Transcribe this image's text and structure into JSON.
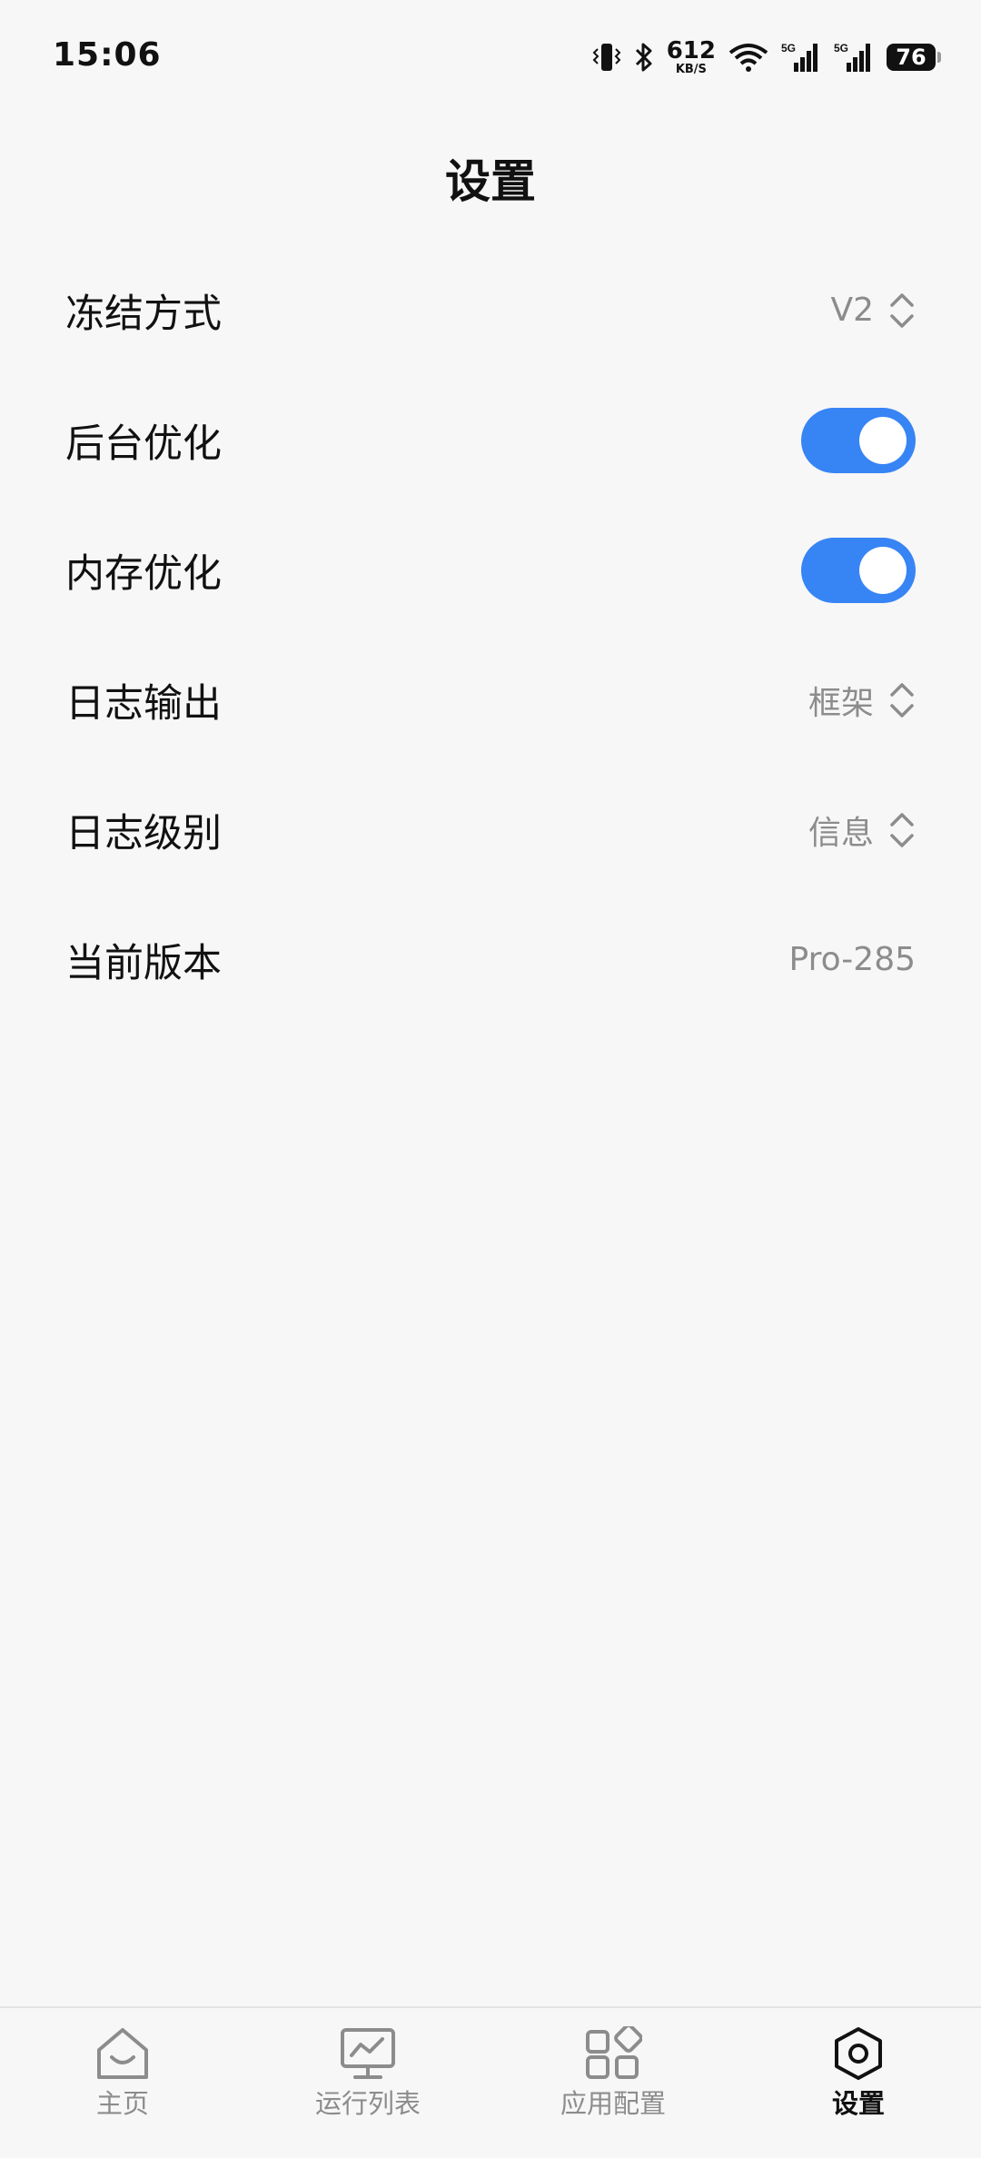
{
  "status_bar": {
    "time": "15:06",
    "net_speed": "612",
    "net_speed_unit": "KB/S",
    "battery": "76",
    "icons": [
      "vibrate-icon",
      "bluetooth-icon",
      "wifi-icon",
      "signal-5g-icon",
      "signal-5g-icon"
    ]
  },
  "header": {
    "title": "设置"
  },
  "settings": [
    {
      "label": "冻结方式",
      "type": "select",
      "value": "V2"
    },
    {
      "label": "后台优化",
      "type": "toggle",
      "enabled": true
    },
    {
      "label": "内存优化",
      "type": "toggle",
      "enabled": true
    },
    {
      "label": "日志输出",
      "type": "select",
      "value": "框架"
    },
    {
      "label": "日志级别",
      "type": "select",
      "value": "信息"
    },
    {
      "label": "当前版本",
      "type": "text",
      "value": "Pro-285"
    }
  ],
  "bottom_nav": {
    "items": [
      {
        "label": "主页",
        "icon": "home-icon",
        "active": false
      },
      {
        "label": "运行列表",
        "icon": "monitor-icon",
        "active": false
      },
      {
        "label": "应用配置",
        "icon": "apps-grid-icon",
        "active": false
      },
      {
        "label": "设置",
        "icon": "hexagon-settings-icon",
        "active": true
      }
    ]
  },
  "colors": {
    "background": "#f7f7f7",
    "accent": "#3784f5",
    "text_primary": "#111111",
    "text_secondary": "#8c8c8c"
  }
}
